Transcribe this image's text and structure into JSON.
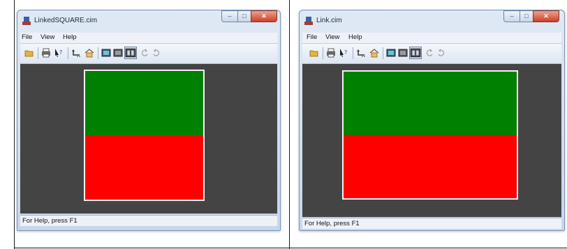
{
  "windows": [
    {
      "title": "LinkedSQUARE.cim",
      "menu": [
        "File",
        "View",
        "Help"
      ],
      "status": "For Help, press F1",
      "controls": {
        "minimize": "–",
        "maximize": "□",
        "close": "✕"
      },
      "square_colors": {
        "top": "#008000",
        "bottom": "#ff0000"
      }
    },
    {
      "title": "Link.cim",
      "menu": [
        "File",
        "View",
        "Help"
      ],
      "status": "For Help, press F1",
      "controls": {
        "minimize": "–",
        "maximize": "□",
        "close": "✕"
      },
      "square_colors": {
        "top": "#008000",
        "bottom": "#ff0000"
      }
    }
  ],
  "toolbar_icons": [
    "open-folder-icon",
    "print-icon",
    "context-help-icon",
    "go-back-icon",
    "home-icon",
    "view-mode-1-icon",
    "view-mode-2-icon",
    "view-mode-3-icon",
    "rotate-left-icon",
    "rotate-right-icon"
  ],
  "colors": {
    "canvas": "#444444",
    "square_border": "#f2f2f2"
  }
}
